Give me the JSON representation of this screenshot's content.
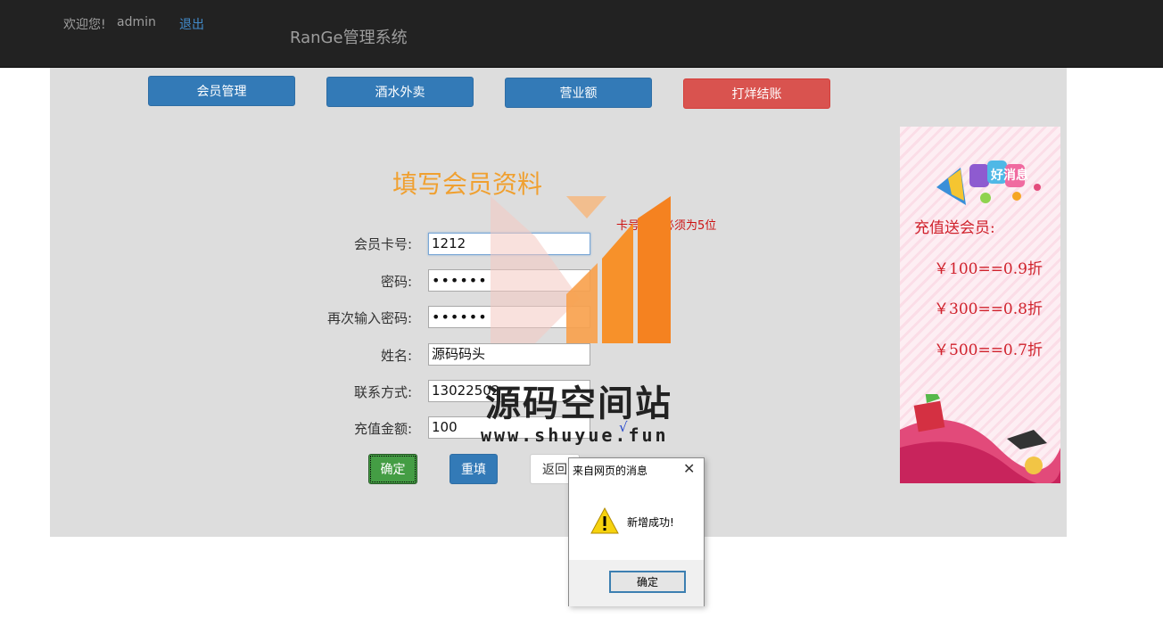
{
  "navbar": {
    "welcome": "欢迎您!",
    "username": "admin",
    "logout": "退出",
    "brand": "RanGe管理系统"
  },
  "tabs": [
    {
      "label": "会员管理"
    },
    {
      "label": "酒水外卖"
    },
    {
      "label": "营业额"
    },
    {
      "label": "打烊结账"
    }
  ],
  "form": {
    "title": "填写会员资料",
    "hint": "卡号长度必须为5位",
    "check_mark": "√",
    "fields": {
      "card": {
        "label": "会员卡号:",
        "value": "1212"
      },
      "password": {
        "label": "密码:",
        "value": "••••••"
      },
      "password2": {
        "label": "再次输入密码:",
        "value": "••••••"
      },
      "name": {
        "label": "姓名:",
        "value": "源码码头"
      },
      "phone": {
        "label": "联系方式:",
        "value": "13022502"
      },
      "amount": {
        "label": "充值金额:",
        "value": "100"
      }
    },
    "buttons": {
      "confirm": "确定",
      "reset": "重填",
      "back": "返回"
    }
  },
  "ad": {
    "banner": "好消息",
    "heading": "充值送会员:",
    "offers": [
      "￥100==0.9折",
      "￥300==0.8折",
      "￥500==0.7折"
    ]
  },
  "watermark": {
    "name": "源码空间站",
    "url": "www.shuyue.fun"
  },
  "dialog": {
    "title": "来自网页的消息",
    "close": "✕",
    "message": "新增成功!",
    "ok": "确定"
  },
  "colors": {
    "navbar": "#222222",
    "panel": "#dddddd",
    "primary": "#337ab7",
    "danger": "#d9534f",
    "success": "#449d44",
    "title": "#f0a030"
  }
}
